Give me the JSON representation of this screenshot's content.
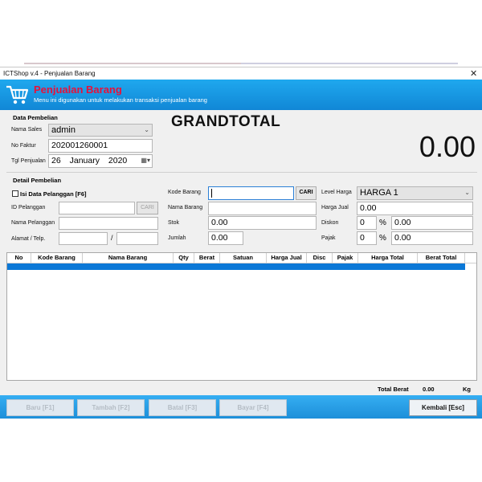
{
  "window": {
    "title": "ICTShop v.4 - Penjualan Barang",
    "close": "✕"
  },
  "banner": {
    "title": "Penjualan Barang",
    "subtitle": "Menu ini digunakan untuk melakukan transaksi penjualan barang",
    "icon": "cart-icon"
  },
  "data_pembelian": {
    "group_title": "Data Pembelian",
    "nama_sales_label": "Nama Sales",
    "nama_sales_value": "admin",
    "no_faktur_label": "No Faktur",
    "no_faktur_value": "202001260001",
    "tgl_label": "Tgl Penjualan",
    "tgl_day": "26",
    "tgl_month": "January",
    "tgl_year": "2020"
  },
  "grandtotal": {
    "label": "GRANDTOTAL",
    "value": "0.00"
  },
  "detail_pembelian": {
    "group_title": "Detail Pembelian",
    "isi_pelanggan_label": "Isi Data Pelanggan [F6]",
    "id_pelanggan_label": "ID Pelanggan",
    "cari_pelanggan": "CARI",
    "nama_pelanggan_label": "Nama Pelanggan",
    "alamat_label": "Alamat / Telp.",
    "alamat_sep": "/"
  },
  "barang": {
    "kode_label": "Kode Barang",
    "cari": "CARI",
    "nama_label": "Nama Barang",
    "stok_label": "Stok",
    "stok_value": "0.00",
    "jumlah_label": "Jumlah",
    "jumlah_value": "0.00"
  },
  "harga": {
    "level_label": "Level Harga",
    "level_value": "HARGA 1",
    "jual_label": "Harga Jual",
    "jual_value": "0.00",
    "diskon_label": "Diskon",
    "diskon_pct": "0",
    "diskon_value": "0.00",
    "pajak_label": "Pajak",
    "pajak_pct": "0",
    "pajak_value": "0.00",
    "pct_sign": "%"
  },
  "table": {
    "columns": [
      "No",
      "Kode Barang",
      "Nama Barang",
      "Qty",
      "Berat",
      "Satuan",
      "Harga Jual",
      "Disc",
      "Pajak",
      "Harga Total",
      "Berat Total"
    ]
  },
  "footer": {
    "total_berat_label": "Total Berat",
    "total_berat_value": "0.00",
    "unit": "Kg"
  },
  "buttons": {
    "baru": "Baru [F1]",
    "tambah": "Tambah [F2]",
    "batal": "Batal [F3]",
    "bayar": "Bayar [F4]",
    "kembali": "Kembali [Esc]"
  },
  "colors": {
    "banner_blue": "#1187d6",
    "banner_title": "#e8103a",
    "selection_blue": "#0b78d7"
  }
}
